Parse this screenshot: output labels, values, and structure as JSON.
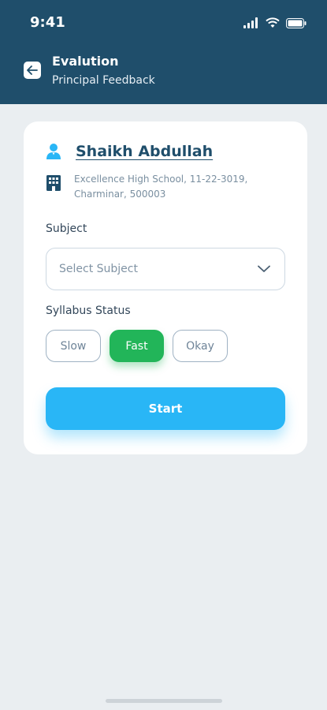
{
  "status_bar": {
    "time": "9:41"
  },
  "header": {
    "title": "Evalution",
    "subtitle": "Principal Feedback"
  },
  "profile": {
    "name": "Shaikh Abdullah",
    "school_line1": "Excellence High School, 11-22-3019,",
    "school_line2": "Charminar, 500003"
  },
  "form": {
    "subject_label": "Subject",
    "subject_placeholder": "Select Subject",
    "syllabus_label": "Syllabus Status",
    "status_options": [
      "Slow",
      "Fast",
      "Okay"
    ],
    "selected_status": "Fast",
    "start_label": "Start"
  },
  "colors": {
    "header_bg": "#1f4e6b",
    "accent_blue": "#29b6f6",
    "selected_green": "#22b559",
    "page_bg": "#eaeef1"
  },
  "icons": {
    "back": "arrow-left-icon",
    "user": "user-icon",
    "school": "building-icon",
    "dropdown": "chevron-down-icon"
  }
}
